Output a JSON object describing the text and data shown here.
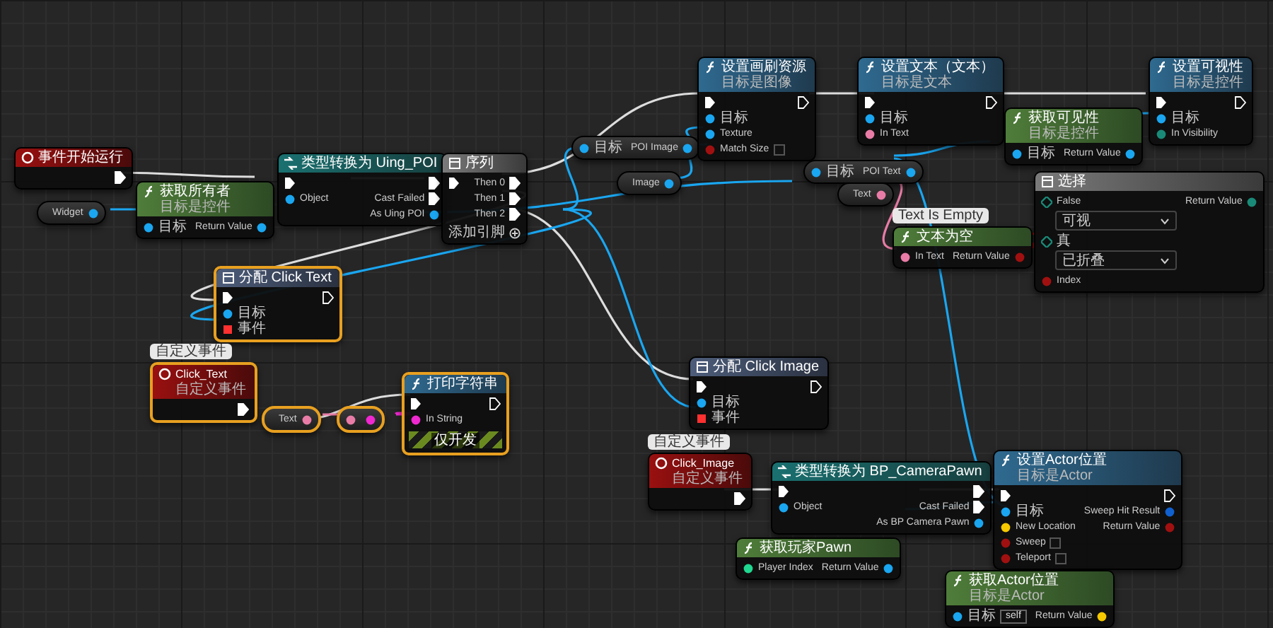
{
  "nodes": [
    {
      "kind": "event",
      "title": "事件开始运行",
      "selected": false,
      "outputs": [
        {
          "kind": "exec"
        }
      ]
    },
    {
      "kind": "variable",
      "selected": false,
      "outputs": [
        {
          "label": "Widget",
          "kind": "object"
        }
      ]
    },
    {
      "kind": "pure",
      "title": "获取所有者",
      "subtitle": "目标是控件",
      "selected": false,
      "inputs": [
        {
          "label": "目标",
          "kind": "object"
        }
      ],
      "outputs": [
        {
          "label": "Return Value",
          "kind": "object"
        }
      ]
    },
    {
      "kind": "cast",
      "title": "类型转换为 Uing_POI",
      "selected": false,
      "inputs": [
        {
          "kind": "exec"
        },
        {
          "label": "Object",
          "kind": "object"
        }
      ],
      "outputs": [
        {
          "kind": "exec"
        },
        {
          "label": "Cast Failed",
          "kind": "exec"
        },
        {
          "label": "As Uing POI",
          "kind": "object"
        }
      ]
    },
    {
      "kind": "macro",
      "title": "序列",
      "selected": false,
      "inputs": [
        {
          "kind": "exec"
        }
      ],
      "outputs": [
        {
          "label": "Then 0",
          "kind": "exec"
        },
        {
          "label": "Then 1",
          "kind": "exec"
        },
        {
          "label": "Then 2",
          "kind": "exec"
        }
      ],
      "footer": {
        "kind": "add_pin",
        "label": "添加引脚"
      }
    },
    {
      "kind": "variable",
      "selected": false,
      "inputs": [
        {
          "label": "目标",
          "kind": "object"
        }
      ],
      "outputs": [
        {
          "label": "POI Image",
          "kind": "object"
        }
      ]
    },
    {
      "kind": "variable",
      "selected": false,
      "outputs": [
        {
          "label": "Image",
          "kind": "object"
        }
      ]
    },
    {
      "kind": "function",
      "title": "设置画刷资源",
      "subtitle": "目标是图像",
      "selected": false,
      "inputs": [
        {
          "kind": "exec"
        },
        {
          "label": "目标",
          "kind": "object"
        },
        {
          "label": "Texture",
          "kind": "object"
        },
        {
          "label": "Match Size",
          "kind": "bool"
        }
      ],
      "outputs": [
        {
          "kind": "exec"
        }
      ]
    },
    {
      "kind": "variable",
      "selected": false,
      "inputs": [
        {
          "label": "目标",
          "kind": "object"
        }
      ],
      "outputs": [
        {
          "label": "POI Text",
          "kind": "object"
        }
      ]
    },
    {
      "kind": "variable",
      "selected": false,
      "outputs": [
        {
          "label": "Text",
          "kind": "text"
        }
      ]
    },
    {
      "kind": "function",
      "title": "设置文本（文本）",
      "subtitle": "目标是文本",
      "selected": false,
      "inputs": [
        {
          "kind": "exec"
        },
        {
          "label": "目标",
          "kind": "object"
        },
        {
          "label": "In Text",
          "kind": "text"
        }
      ],
      "outputs": [
        {
          "kind": "exec"
        }
      ]
    },
    {
      "kind": "pure",
      "title": "获取可见性",
      "subtitle": "目标是控件",
      "selected": false,
      "inputs": [
        {
          "label": "目标",
          "kind": "object"
        }
      ],
      "outputs": [
        {
          "label": "Return Value",
          "kind": "object"
        }
      ]
    },
    {
      "kind": "function",
      "title": "设置可视性",
      "subtitle": "目标是控件",
      "selected": false,
      "inputs": [
        {
          "kind": "exec"
        },
        {
          "label": "目标",
          "kind": "object"
        },
        {
          "label": "In Visibility",
          "kind": "byte"
        }
      ],
      "outputs": [
        {
          "kind": "exec"
        }
      ]
    },
    {
      "kind": "select",
      "title": "选择",
      "selected": false,
      "inputs": [
        {
          "label": "False",
          "kind": "option",
          "value": "可视"
        },
        {
          "label": "真",
          "kind": "option",
          "value": "已折叠"
        },
        {
          "label": "Index",
          "kind": "bool"
        }
      ],
      "outputs": [
        {
          "label": "Return Value",
          "kind": "byte"
        }
      ]
    },
    {
      "kind": "pure",
      "title": "文本为空",
      "comment": "Text Is Empty",
      "selected": false,
      "inputs": [
        {
          "label": "In Text",
          "kind": "text"
        }
      ],
      "outputs": [
        {
          "label": "Return Value",
          "kind": "bool"
        }
      ]
    },
    {
      "kind": "bind",
      "title": "分配 Click Text",
      "selected": true,
      "inputs": [
        {
          "kind": "exec"
        },
        {
          "label": "目标",
          "kind": "object"
        },
        {
          "label": "事件",
          "kind": "event"
        }
      ],
      "outputs": [
        {
          "kind": "exec"
        }
      ]
    },
    {
      "kind": "custom",
      "title": "Click_Text",
      "subtitle": "自定义事件",
      "comment": "自定义事件",
      "selected": true,
      "outputs": [
        {
          "kind": "exec"
        }
      ]
    },
    {
      "kind": "variable",
      "selected": true,
      "outputs": [
        {
          "label": "Text",
          "kind": "text"
        }
      ]
    },
    {
      "kind": "convert",
      "selected": true,
      "inputs": [
        {
          "kind": "text"
        }
      ],
      "outputs": [
        {
          "kind": "string"
        }
      ]
    },
    {
      "kind": "function",
      "title": "打印字符串",
      "selected": true,
      "inputs": [
        {
          "kind": "exec"
        },
        {
          "label": "In String",
          "kind": "string"
        }
      ],
      "outputs": [
        {
          "kind": "exec"
        }
      ],
      "footer": {
        "kind": "dev_only",
        "label": "仅开发"
      }
    },
    {
      "kind": "bind",
      "title": "分配 Click Image",
      "selected": false,
      "inputs": [
        {
          "kind": "exec"
        },
        {
          "label": "目标",
          "kind": "object"
        },
        {
          "label": "事件",
          "kind": "event"
        }
      ],
      "outputs": [
        {
          "kind": "exec"
        }
      ]
    },
    {
      "kind": "custom",
      "title": "Click_Image",
      "subtitle": "自定义事件",
      "comment": "自定义事件",
      "selected": false,
      "outputs": [
        {
          "kind": "exec"
        }
      ]
    },
    {
      "kind": "cast",
      "title": "类型转换为 BP_CameraPawn",
      "selected": false,
      "inputs": [
        {
          "kind": "exec"
        },
        {
          "label": "Object",
          "kind": "object"
        }
      ],
      "outputs": [
        {
          "kind": "exec"
        },
        {
          "label": "Cast Failed",
          "kind": "exec"
        },
        {
          "label": "As BP Camera Pawn",
          "kind": "object"
        }
      ]
    },
    {
      "kind": "pure",
      "title": "获取玩家Pawn",
      "selected": false,
      "inputs": [
        {
          "label": "Player Index",
          "kind": "int"
        }
      ],
      "outputs": [
        {
          "label": "Return Value",
          "kind": "object"
        }
      ]
    },
    {
      "kind": "function",
      "title": "设置Actor位置",
      "subtitle": "目标是Actor",
      "selected": false,
      "inputs": [
        {
          "kind": "exec"
        },
        {
          "label": "目标",
          "kind": "object"
        },
        {
          "label": "New Location",
          "kind": "vector"
        },
        {
          "label": "Sweep",
          "kind": "bool"
        },
        {
          "label": "Teleport",
          "kind": "bool"
        }
      ],
      "outputs": [
        {
          "kind": "exec"
        },
        {
          "label": "Sweep Hit Result",
          "kind": "struct"
        },
        {
          "label": "Return Value",
          "kind": "bool"
        }
      ]
    },
    {
      "kind": "pure",
      "title": "获取Actor位置",
      "subtitle": "目标是Actor",
      "selected": false,
      "inputs": [
        {
          "label": "目标",
          "kind": "object",
          "value": "self"
        }
      ],
      "outputs": [
        {
          "label": "Return Value",
          "kind": "vector"
        }
      ]
    }
  ]
}
